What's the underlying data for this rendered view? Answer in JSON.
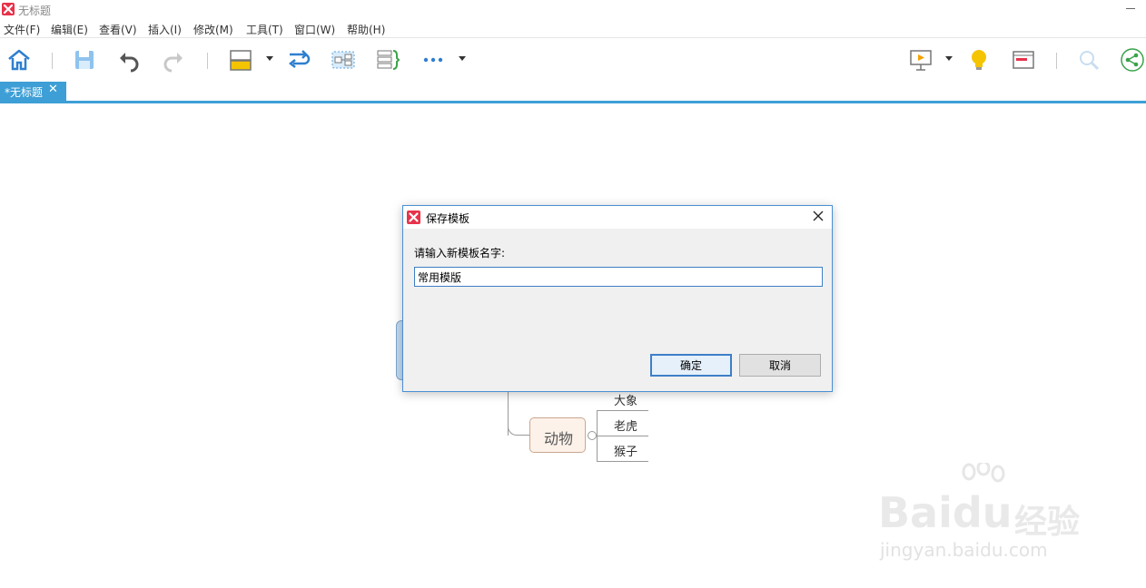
{
  "window": {
    "title": "无标题"
  },
  "menu": {
    "items": [
      {
        "label": "文件(F)"
      },
      {
        "label": "编辑(E)"
      },
      {
        "label": "查看(V)"
      },
      {
        "label": "插入(I)"
      },
      {
        "label": "修改(M)"
      },
      {
        "label": "工具(T)"
      },
      {
        "label": "窗口(W)"
      },
      {
        "label": "帮助(H)"
      }
    ]
  },
  "toolbar": {
    "icons": [
      "home-icon",
      "save-icon",
      "undo-icon",
      "redo-icon",
      "topic-style-icon",
      "relationship-icon",
      "boundary-icon",
      "summary-icon",
      "more-icon",
      "presentation-icon",
      "idea-icon",
      "gantt-icon",
      "search-icon",
      "share-icon"
    ],
    "colors": {
      "accent": "#3d9fd6",
      "icon_blue": "#2f7fd0",
      "icon_gray": "#555555",
      "highlight_yellow": "#f5c400"
    }
  },
  "tabs": [
    {
      "label": "*无标题",
      "active": true
    }
  ],
  "map": {
    "topic": "动物",
    "subtopics": [
      "大象",
      "老虎",
      "猴子"
    ]
  },
  "watermark": {
    "brand": "Baidu",
    "brand_cn": "经验",
    "url": "jingyan.baidu.com"
  },
  "dialog": {
    "title": "保存模板",
    "prompt": "请输入新模板名字:",
    "input_value": "常用模版",
    "ok_label": "确定",
    "cancel_label": "取消"
  }
}
